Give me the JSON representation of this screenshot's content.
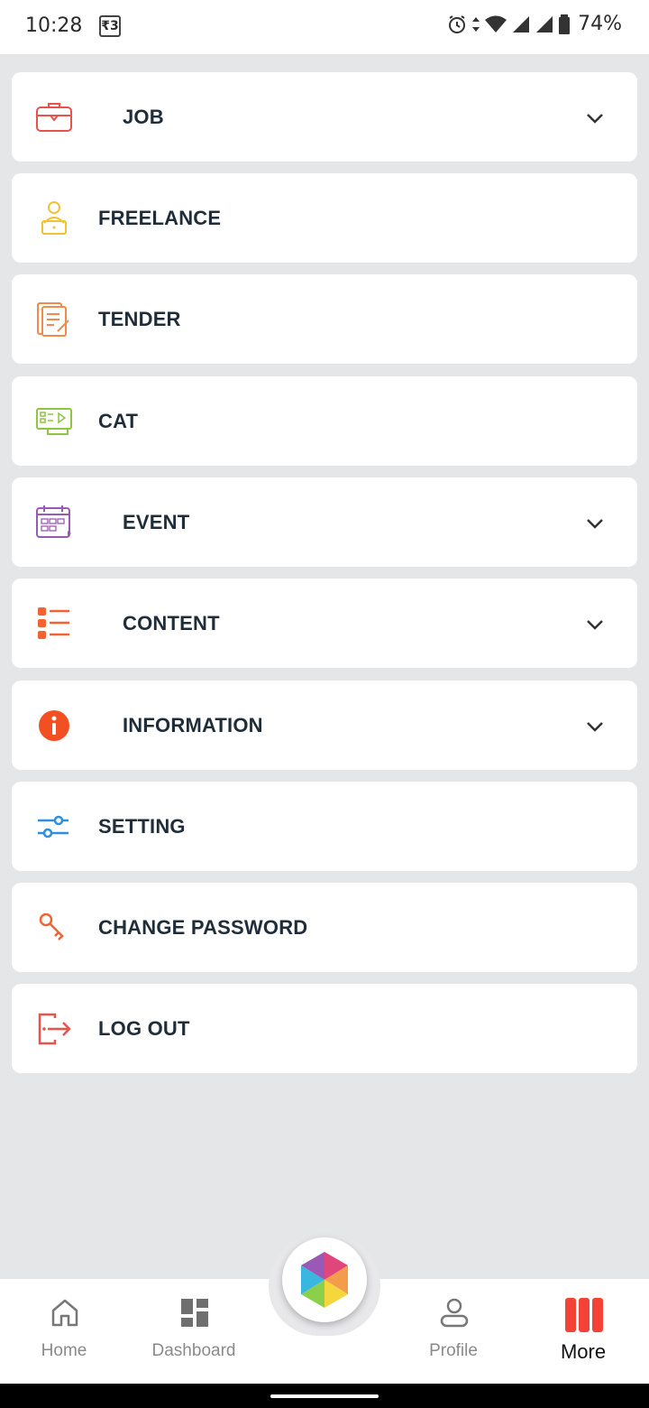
{
  "status_bar": {
    "time": "10:28",
    "rupee_icon": "₹3",
    "battery_percent": "74%"
  },
  "menu": {
    "items": [
      {
        "label": "JOB",
        "icon": "briefcase-icon",
        "color": "#e8524b",
        "expandable": true
      },
      {
        "label": "FREELANCE",
        "icon": "freelancer-icon",
        "color": "#f2c233",
        "expandable": false
      },
      {
        "label": "TENDER",
        "icon": "document-sign-icon",
        "color": "#f28a4b",
        "expandable": false
      },
      {
        "label": "CAT",
        "icon": "presentation-icon",
        "color": "#8dc63f",
        "expandable": false
      },
      {
        "label": "EVENT",
        "icon": "calendar-icon",
        "color": "#9b59b6",
        "expandable": true
      },
      {
        "label": "CONTENT",
        "icon": "list-icon",
        "color": "#f26331",
        "expandable": true
      },
      {
        "label": "INFORMATION",
        "icon": "info-icon",
        "color": "#f25022",
        "expandable": true
      },
      {
        "label": "SETTING",
        "icon": "sliders-icon",
        "color": "#2d8fe0",
        "expandable": false
      },
      {
        "label": "CHANGE PASSWORD",
        "icon": "key-icon",
        "color": "#f26331",
        "expandable": false
      },
      {
        "label": "LOG OUT",
        "icon": "logout-icon",
        "color": "#e8524b",
        "expandable": false
      }
    ]
  },
  "bottom_nav": {
    "home": "Home",
    "dashboard": "Dashboard",
    "profile": "Profile",
    "more": "More",
    "active": "More",
    "active_color": "#f44336"
  }
}
